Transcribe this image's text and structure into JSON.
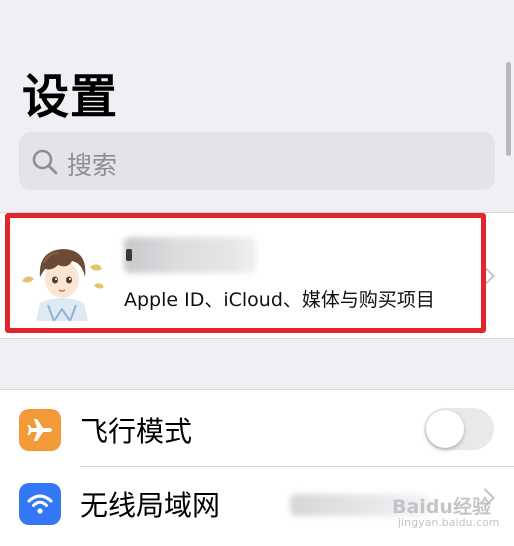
{
  "header": {
    "title": "设置"
  },
  "search": {
    "placeholder": "搜索"
  },
  "profile": {
    "subtitle": "Apple ID、iCloud、媒体与购买项目"
  },
  "settings": {
    "items": [
      {
        "label": "飞行模式",
        "icon": "airplane-icon",
        "icon_color": "#f19a37",
        "toggle_on": false
      },
      {
        "label": "无线局域网",
        "icon": "wifi-icon",
        "icon_color": "#3478f6"
      }
    ]
  },
  "watermark": {
    "logo_text": "Baidu经验",
    "sub_text": "jingyan.baidu.com"
  },
  "colors": {
    "background": "#efeff4",
    "highlight": "#e3242b"
  }
}
